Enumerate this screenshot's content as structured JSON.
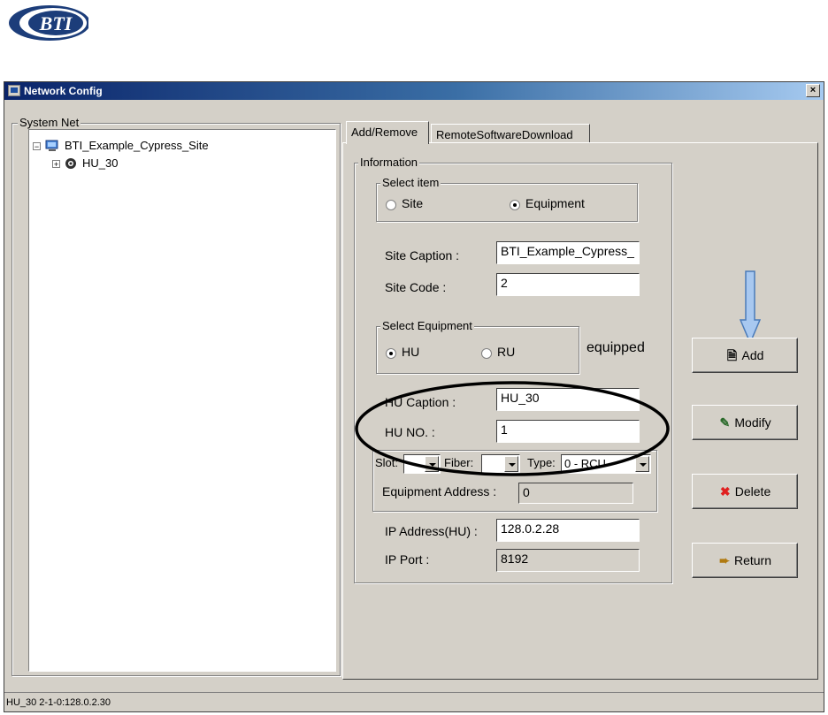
{
  "logo": {
    "text": "BTI"
  },
  "window": {
    "title": "Network Config",
    "close_label": "×"
  },
  "tree": {
    "group_label": "System Net",
    "root_label": "BTI_Example_Cypress_Site",
    "child_label": "HU_30",
    "root_expander": "−",
    "child_expander": "+"
  },
  "tabs": [
    {
      "label": "Add/Remove",
      "active": true
    },
    {
      "label": "RemoteSoftwareDownload",
      "active": false
    }
  ],
  "info": {
    "group_label": "Information",
    "select_item": {
      "label": "Select item",
      "site_label": "Site",
      "equipment_label": "Equipment",
      "selected": "Equipment"
    },
    "site_caption_label": "Site Caption :",
    "site_caption_value": "BTI_Example_Cypress_",
    "site_code_label": "Site Code :",
    "site_code_value": "2",
    "select_equipment": {
      "label": "Select Equipment",
      "hu_label": "HU",
      "ru_label": "RU",
      "selected": "HU"
    },
    "equipped_text": "equipped",
    "hu_caption_label": "HU Caption :",
    "hu_caption_value": "HU_30",
    "hu_no_label": "HU NO. :",
    "hu_no_value": "1",
    "slot_label": "Slot:",
    "fiber_label": "Fiber:",
    "type_label": "Type:",
    "type_value": "0 - RCU",
    "equipment_address_label": "Equipment Address :",
    "equipment_address_value": "0",
    "ip_address_label": "IP Address(HU) :",
    "ip_address_value": "128.0.2.28",
    "ip_port_label": "IP Port :",
    "ip_port_value": "8192"
  },
  "buttons": {
    "add": "Add",
    "modify": "Modify",
    "delete": "Delete",
    "return": "Return"
  },
  "status": {
    "text": "HU_30 2-1-0:128.0.2.30"
  },
  "colors": {
    "accent_arrow": "#a8c8f0",
    "title_bar": "#0a246a",
    "delete_icon": "#e02020"
  }
}
